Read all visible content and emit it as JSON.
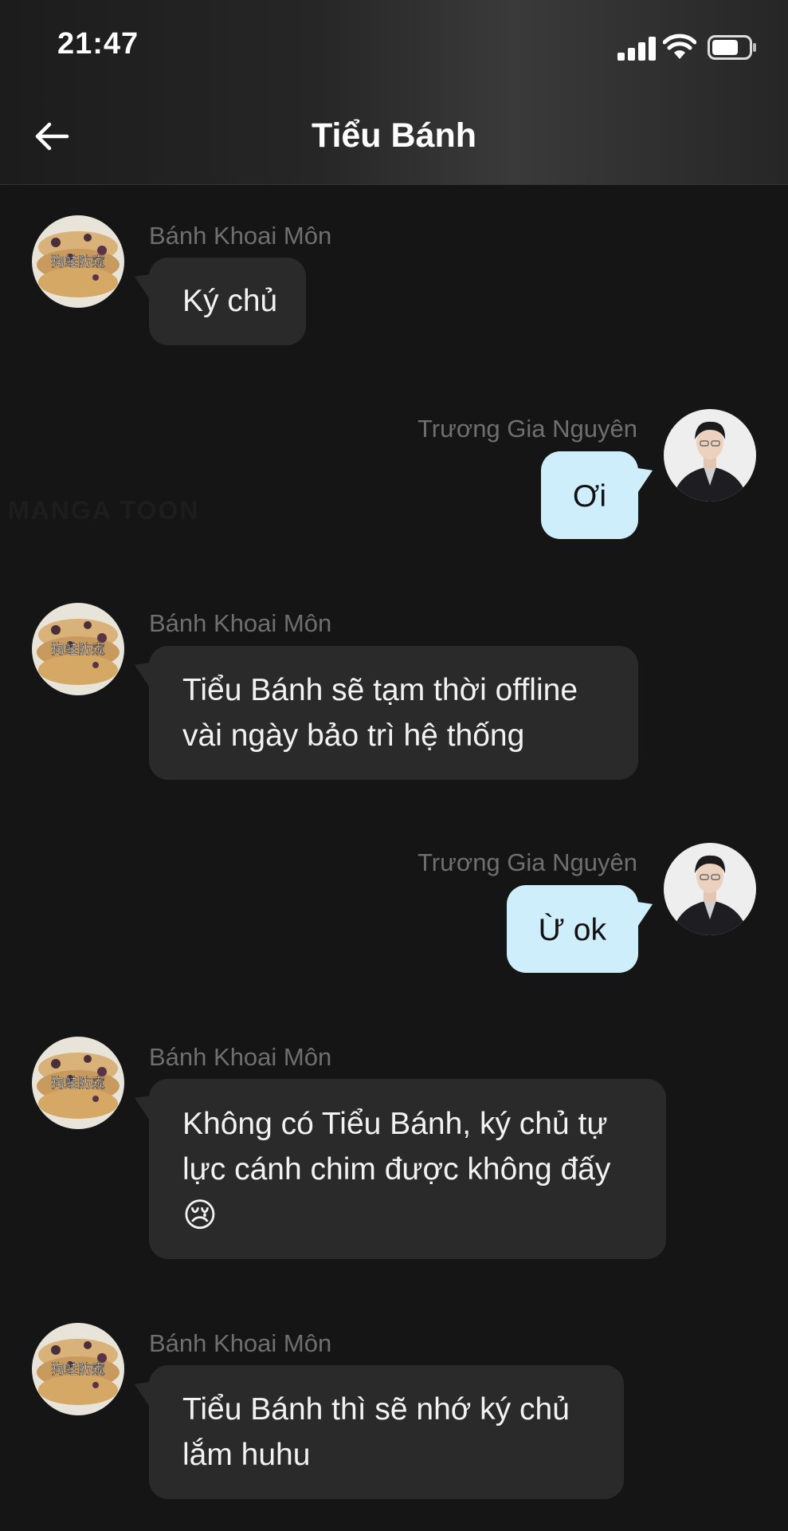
{
  "status_bar": {
    "time": "21:47"
  },
  "header": {
    "title": "Tiểu Bánh"
  },
  "watermark": "MANGA TOON",
  "messages": [
    {
      "sender": "Bánh Khoai Môn",
      "side": "left",
      "text": "Ký chủ"
    },
    {
      "sender": "Trương Gia Nguyên",
      "side": "right",
      "text": "Ơi"
    },
    {
      "sender": "Bánh Khoai Môn",
      "side": "left",
      "line1": "Tiểu Bánh sẽ tạm thời offline",
      "line2": "vài ngày bảo trì hệ thống"
    },
    {
      "sender": "Trương Gia Nguyên",
      "side": "right",
      "text": "Ừ ok"
    },
    {
      "sender": "Bánh Khoai Môn",
      "side": "left",
      "line1": "Không có Tiểu Bánh, ký chủ tự",
      "line2": "lực cánh chim được không đấy",
      "emoji": "😢"
    },
    {
      "sender": "Bánh Khoai Môn",
      "side": "left",
      "line1": "Tiểu Bánh thì sẽ nhớ ký chủ",
      "line2": "lắm huhu"
    }
  ],
  "avatar_caption": "狗蛙防窥",
  "colors": {
    "background": "#151515",
    "left_bubble": "#2a2a2a",
    "right_bubble": "#cfeefc",
    "sender_text": "#6f6f6f"
  }
}
